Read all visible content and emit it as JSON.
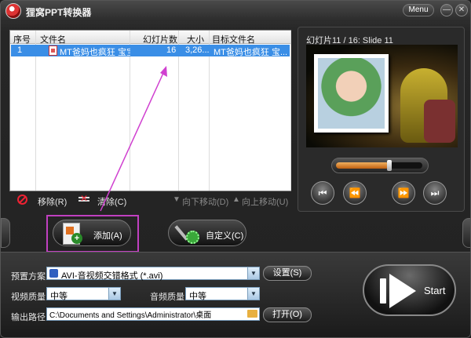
{
  "app": {
    "title": "狸窝PPT转换器",
    "menu_label": "Menu",
    "minimize_glyph": "—",
    "close_glyph": "✕"
  },
  "file_list": {
    "columns": [
      "序号",
      "文件名",
      "幻灯片数",
      "大小",
      "目标文件名"
    ],
    "rows": [
      {
        "index": "1",
        "filename": "MT爸妈也疯狂 宝宝秀",
        "slides": "16",
        "size": "3,26...",
        "target": "MT爸妈也疯狂 宝..."
      }
    ]
  },
  "list_toolbar": {
    "remove": "移除(R)",
    "clear": "清除(C)",
    "move_down": "向下移动(D)",
    "move_up": "向上移动(U)"
  },
  "preview": {
    "slide_info": "幻灯片11 / 16: Slide 11",
    "progress_fraction": 0.62
  },
  "actions": {
    "add": "添加(A)",
    "customize": "自定义(C)",
    "start": "Start"
  },
  "settings": {
    "preset_label": "预置方案:",
    "preset_value": "AVI-音视频交错格式 (*.avi)",
    "preset_button": "设置(S)",
    "video_quality_label": "视频质量:",
    "video_quality_value": "中等",
    "audio_quality_label": "音频质量:",
    "audio_quality_value": "中等",
    "output_label": "输出路径:",
    "output_path": "C:\\Documents and Settings\\Administrator\\桌面",
    "open_button": "打开(O)"
  },
  "icons": {
    "add": "ppt-add-icon",
    "customize": "tools-icon",
    "remove": "remove-icon",
    "clear": "clear-icon",
    "folder": "folder-icon"
  },
  "colors": {
    "selection": "#3a8ee6",
    "annotation": "#c040c0",
    "progress": "#e08030"
  }
}
